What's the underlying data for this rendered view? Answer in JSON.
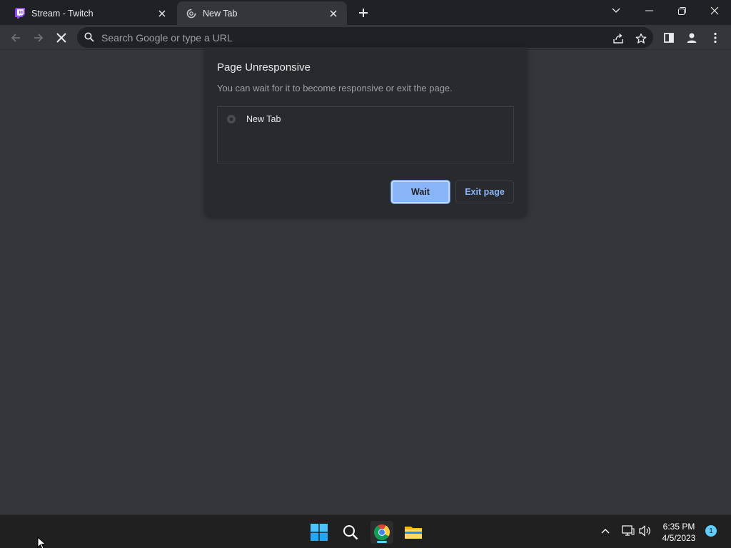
{
  "tabs": [
    {
      "title": "Stream - Twitch",
      "icon": "twitch-icon",
      "active": false
    },
    {
      "title": "New Tab",
      "icon": "loading-icon",
      "active": true
    }
  ],
  "toolbar": {
    "omnibox_placeholder": "Search Google or type a URL"
  },
  "dialog": {
    "title": "Page Unresponsive",
    "message": "You can wait for it to become responsive or exit the page.",
    "pages": [
      {
        "title": "New Tab",
        "icon": "chrome-page-icon"
      }
    ],
    "wait_label": "Wait",
    "exit_label": "Exit page"
  },
  "taskbar": {
    "time": "6:35 PM",
    "date": "4/5/2023",
    "notification_count": "1"
  },
  "colors": {
    "accent": "#8ab4f8",
    "background": "#35363a",
    "tabstrip": "#202124",
    "taskbar": "#202020"
  }
}
